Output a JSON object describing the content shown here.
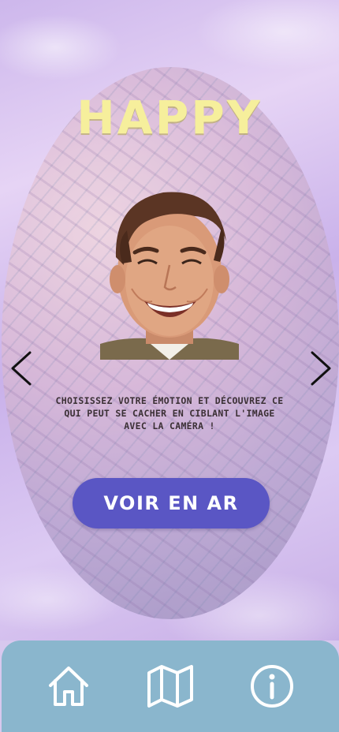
{
  "screen": {
    "title": "HAPPY",
    "instructions": "CHOISISSEZ VOTRE ÉMOTION ET DÉCOUVREZ CE QUI PEUT SE CACHER EN CIBLANT L'IMAGE AVEC LA CAMÉRA !",
    "ar_button_label": "VOIR EN AR"
  },
  "nav": {
    "prev_icon": "chevron-left-icon",
    "next_icon": "chevron-right-icon"
  },
  "bottom_bar": {
    "items": [
      {
        "icon": "home-icon"
      },
      {
        "icon": "map-icon"
      },
      {
        "icon": "info-icon"
      }
    ]
  },
  "colors": {
    "title": "#f6ef9c",
    "button": "#5a56c4",
    "bottom_bar": "#8ab6cd"
  }
}
